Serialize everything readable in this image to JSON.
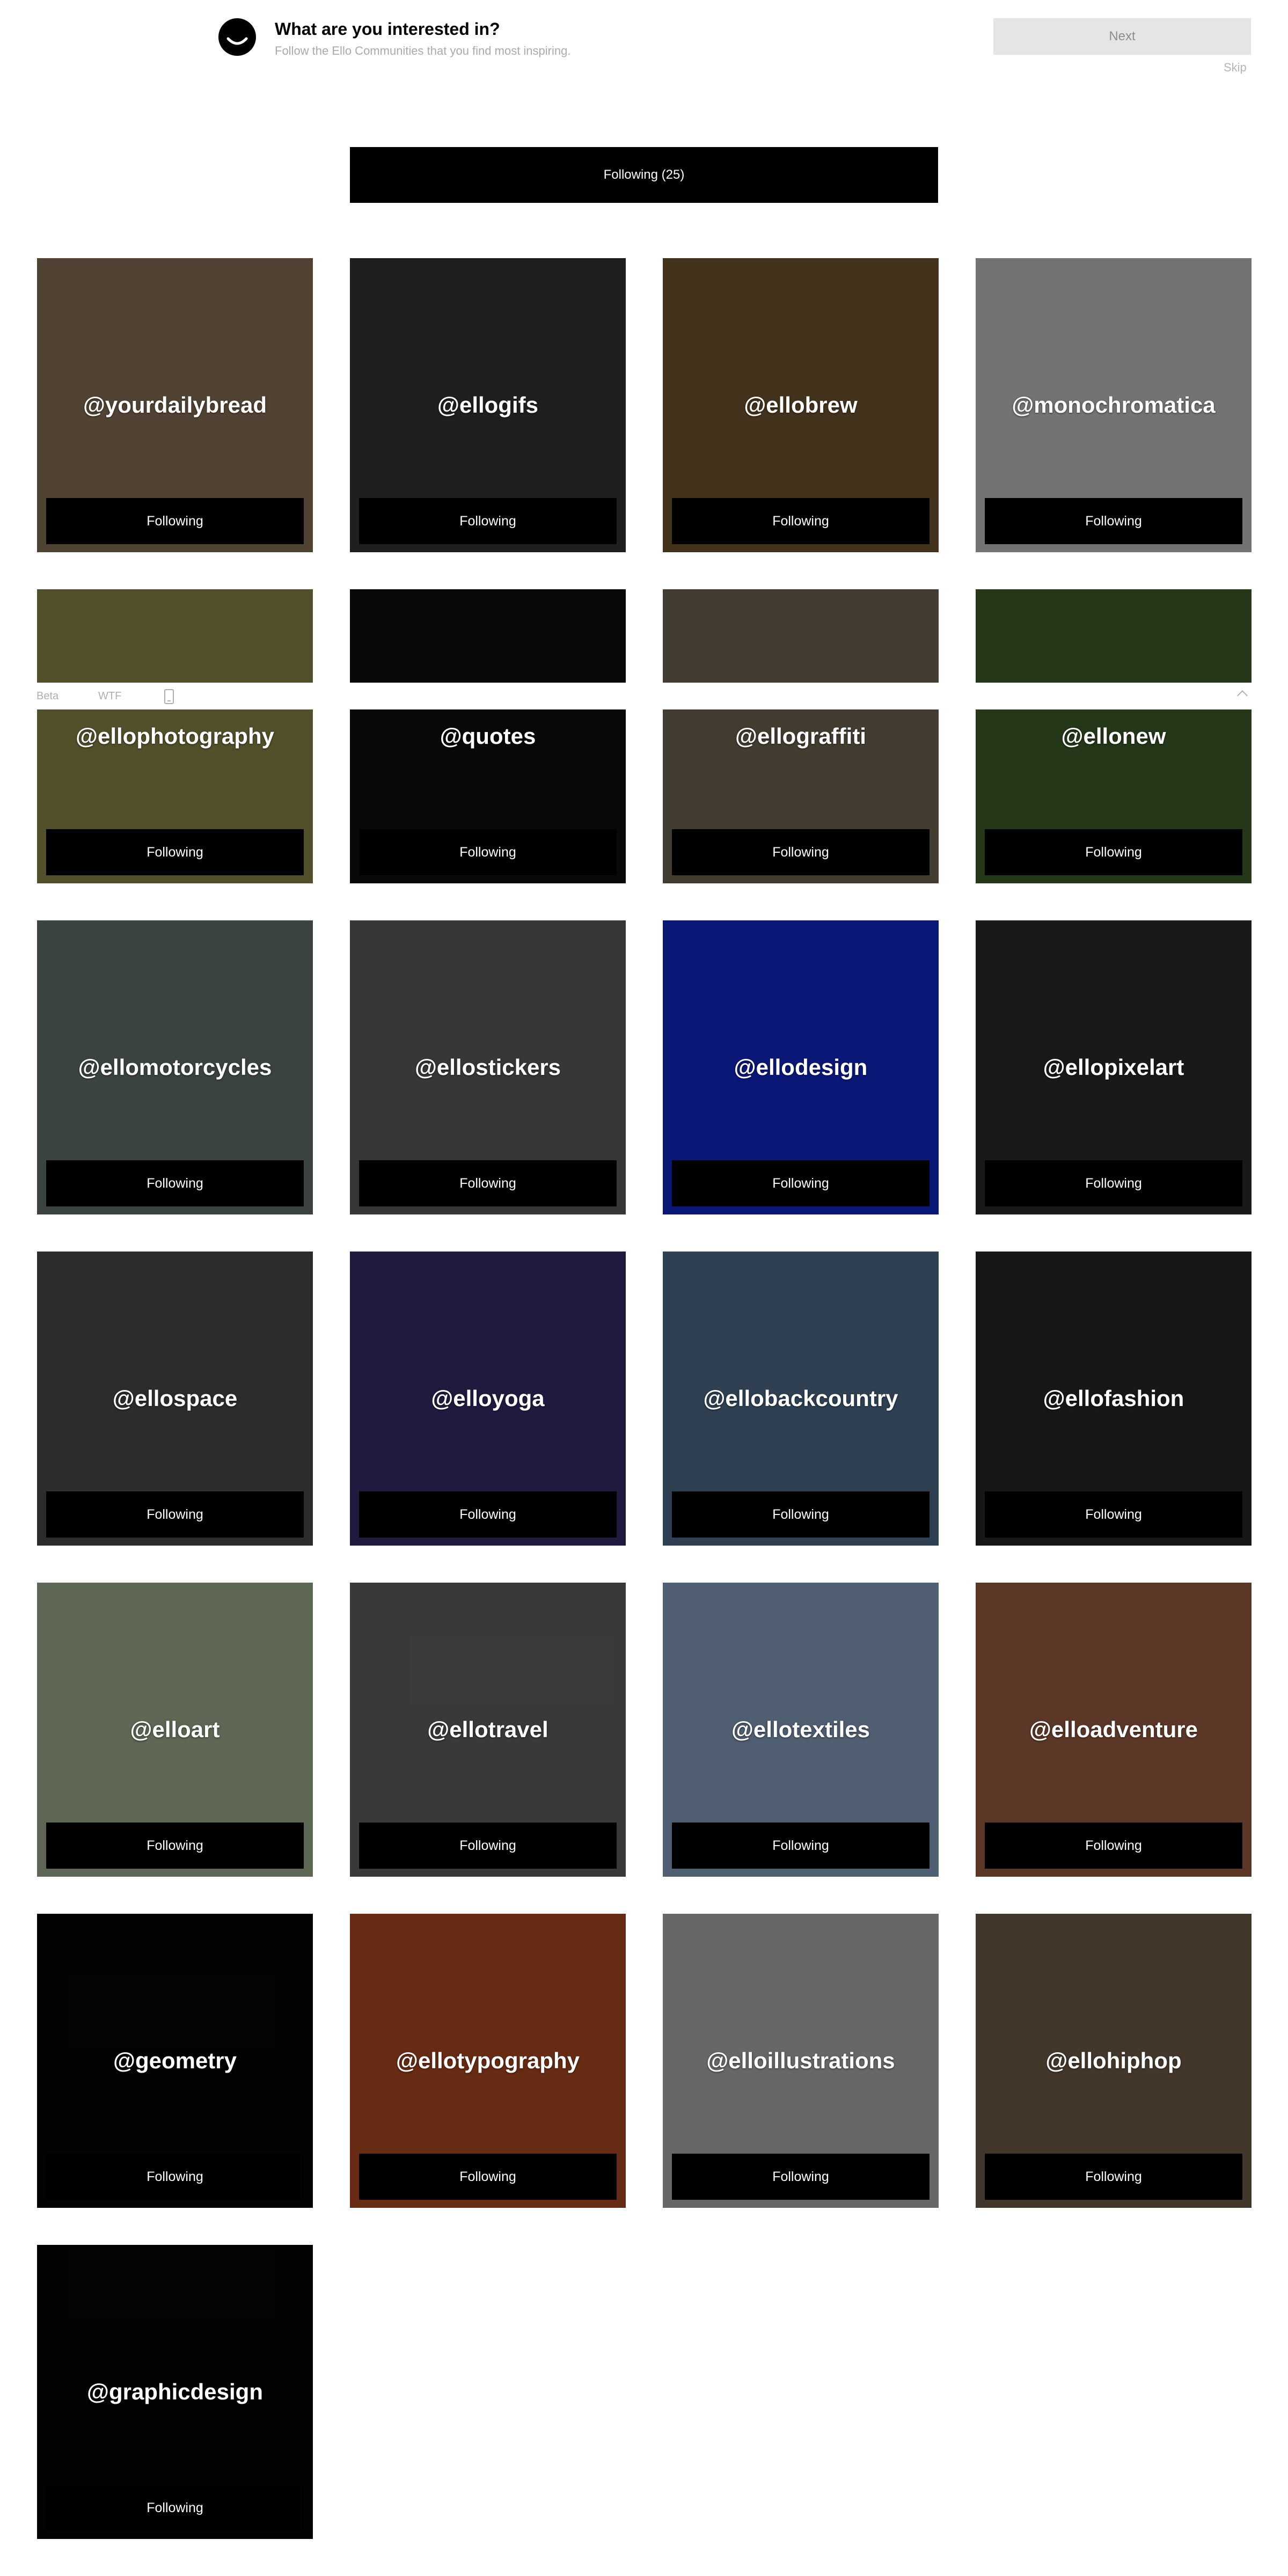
{
  "header": {
    "title": "What are you interested in?",
    "subtitle": "Follow the Ello Communities that you find most inspiring.",
    "next_label": "Next",
    "skip_label": "Skip",
    "logo_icon": "ello-smile-icon"
  },
  "following_all_label": "Following (25)",
  "beta_bar": {
    "beta_label": "Beta",
    "wtf_label": "WTF",
    "phone_icon": "mobile-phone-icon",
    "collapse_icon": "chevron-up-icon"
  },
  "communities": [
    {
      "name": "@yourdailybread",
      "button": "Following",
      "bg": "#6b5a44"
    },
    {
      "name": "@ellogifs",
      "button": "Following",
      "bg": "#2a2a2a"
    },
    {
      "name": "@ellobrew",
      "button": "Following",
      "bg": "#5a4326"
    },
    {
      "name": "@monochromatica",
      "button": "Following",
      "bg": "#9a9a9a"
    },
    {
      "name": "@ellophotography",
      "button": "Following",
      "bg": "#6e6a3a"
    },
    {
      "name": "@quotes",
      "button": "Following",
      "bg": "#0b0b0b"
    },
    {
      "name": "@ellograffiti",
      "button": "Following",
      "bg": "#5a5040"
    },
    {
      "name": "@ellonew",
      "button": "Following",
      "bg": "#314a22"
    },
    {
      "name": "@ellomotorcycles",
      "button": "Following",
      "bg": "#4f5a58"
    },
    {
      "name": "@ellostickers",
      "button": "Following",
      "bg": "#4a4a4a"
    },
    {
      "name": "@ellodesign",
      "button": "Following",
      "bg": "#0f1f9e"
    },
    {
      "name": "@ellopixelart",
      "button": "Following",
      "bg": "#222222"
    },
    {
      "name": "@ellospace",
      "button": "Following",
      "bg": "#3b3b3b"
    },
    {
      "name": "@elloyoga",
      "button": "Following",
      "bg": "#2a2555"
    },
    {
      "name": "@ellobackcountry",
      "button": "Following",
      "bg": "#3e566e"
    },
    {
      "name": "@ellofashion",
      "button": "Following",
      "bg": "#1f1f1f"
    },
    {
      "name": "@elloart",
      "button": "Following",
      "bg": "#7c8a70"
    },
    {
      "name": "@ellotravel",
      "button": "Following",
      "bg": "#4d4d4d"
    },
    {
      "name": "@ellotextiles",
      "button": "Following",
      "bg": "#6a7e96"
    },
    {
      "name": "@elloadventure",
      "button": "Following",
      "bg": "#7a4a35"
    },
    {
      "name": "@geometry",
      "button": "Following",
      "bg": "#050505"
    },
    {
      "name": "@ellotypography",
      "button": "Following",
      "bg": "#8a3a1a"
    },
    {
      "name": "@elloillustrations",
      "button": "Following",
      "bg": "#8a8a8a"
    },
    {
      "name": "@ellohiphop",
      "button": "Following",
      "bg": "#5a4a3a"
    },
    {
      "name": "@graphicdesign",
      "button": "Following",
      "bg": "#050505"
    }
  ]
}
